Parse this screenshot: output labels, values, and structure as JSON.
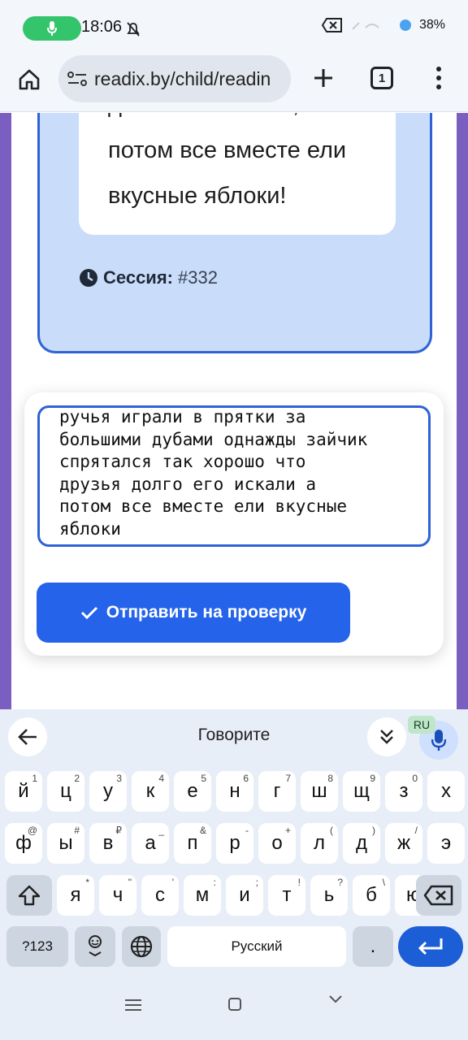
{
  "status": {
    "time": "18:06",
    "battery": "38%"
  },
  "browser": {
    "url": "readix.by/child/readin",
    "tab_count": "1"
  },
  "story": {
    "text": "долго его искали, а потом все вместе ели вкусные яблоки!"
  },
  "session": {
    "label": "Сессия:",
    "number": "#332"
  },
  "answer": {
    "text": "ручья играли в прятки за\nбольшими дубами однажды зайчик\nспрятался так хорошо что\nдрузья долго его искали а\nпотом все вместе ели вкусные\nяблоки"
  },
  "submit": {
    "label": "Отправить на проверку"
  },
  "keyboard": {
    "voice_prompt": "Говорите",
    "lang_badge": "RU",
    "row1": [
      {
        "k": "й",
        "h": "1"
      },
      {
        "k": "ц",
        "h": "2"
      },
      {
        "k": "у",
        "h": "3"
      },
      {
        "k": "к",
        "h": "4"
      },
      {
        "k": "е",
        "h": "5"
      },
      {
        "k": "н",
        "h": "6"
      },
      {
        "k": "г",
        "h": "7"
      },
      {
        "k": "ш",
        "h": "8"
      },
      {
        "k": "щ",
        "h": "9"
      },
      {
        "k": "з",
        "h": "0"
      },
      {
        "k": "х",
        "h": ""
      }
    ],
    "row2": [
      {
        "k": "ф",
        "h": "@"
      },
      {
        "k": "ы",
        "h": "#"
      },
      {
        "k": "в",
        "h": "₽"
      },
      {
        "k": "а",
        "h": "_"
      },
      {
        "k": "п",
        "h": "&"
      },
      {
        "k": "р",
        "h": "-"
      },
      {
        "k": "о",
        "h": "+"
      },
      {
        "k": "л",
        "h": "("
      },
      {
        "k": "д",
        "h": ")"
      },
      {
        "k": "ж",
        "h": "/"
      },
      {
        "k": "э",
        "h": ""
      }
    ],
    "row3": [
      {
        "k": "я",
        "h": "*"
      },
      {
        "k": "ч",
        "h": "\""
      },
      {
        "k": "с",
        "h": "'"
      },
      {
        "k": "м",
        "h": ":"
      },
      {
        "k": "и",
        "h": ";"
      },
      {
        "k": "т",
        "h": "!"
      },
      {
        "k": "ь",
        "h": "?"
      },
      {
        "k": "б",
        "h": "\\"
      },
      {
        "k": "ю",
        "h": "%"
      }
    ],
    "symbols_label": "?123",
    "space_label": "Русский",
    "period_label": "."
  }
}
